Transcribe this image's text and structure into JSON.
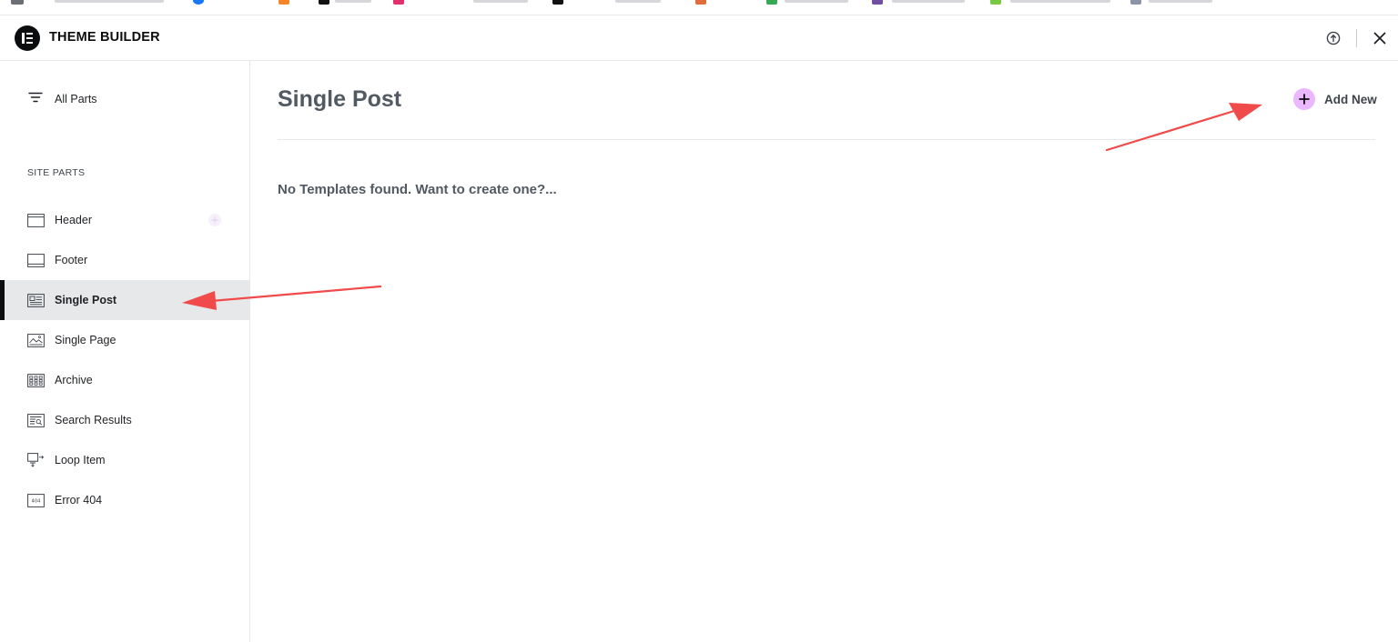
{
  "app": {
    "title": "THEME BUILDER",
    "logo_icon": "elementor-logo-icon",
    "info_icon": "info-upload-icon",
    "close_icon": "close-icon"
  },
  "sidebar": {
    "all_parts": {
      "label": "All Parts",
      "icon": "filter-icon"
    },
    "section_label": "SITE PARTS",
    "items": [
      {
        "label": "Header",
        "icon": "header-layout-icon",
        "active": false
      },
      {
        "label": "Footer",
        "icon": "footer-layout-icon",
        "active": false
      },
      {
        "label": "Single Post",
        "icon": "single-post-icon",
        "active": true
      },
      {
        "label": "Single Page",
        "icon": "single-page-icon",
        "active": false
      },
      {
        "label": "Archive",
        "icon": "archive-grid-icon",
        "active": false
      },
      {
        "label": "Search Results",
        "icon": "search-results-icon",
        "active": false
      },
      {
        "label": "Loop Item",
        "icon": "loop-item-icon",
        "active": false
      },
      {
        "label": "Error 404",
        "icon": "error-404-icon",
        "active": false
      }
    ]
  },
  "main": {
    "title": "Single Post",
    "add_new_label": "Add New",
    "empty_message": "No Templates found. Want to create one?..."
  },
  "colors": {
    "accent_add": "#ebb7ff",
    "active_bg": "#e6e8ea",
    "annotation_arrow": "#f04a4a"
  }
}
